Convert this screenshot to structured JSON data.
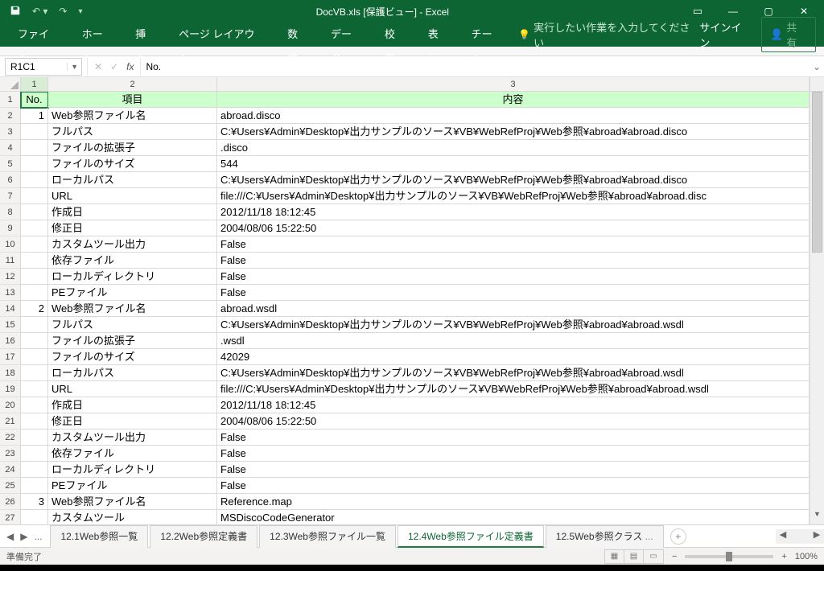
{
  "colors": {
    "brand": "#0e6534",
    "headerFill": "#ccffcc"
  },
  "titlebar": {
    "title": "DocVB.xls  [保護ビュー] - Excel",
    "icons": {
      "save": "save-icon",
      "undo": "undo-icon",
      "redo": "redo-icon",
      "customize": "chevron-down-icon"
    }
  },
  "windowControls": {
    "ribbonopts": "▭",
    "minimize": "—",
    "maximize": "▢",
    "close": "✕"
  },
  "ribbon": {
    "tabs": [
      "ファイル",
      "ホーム",
      "挿入",
      "ページ レイアウト",
      "数式",
      "データ",
      "校閲",
      "表示",
      "チーム"
    ],
    "tellme": "実行したい作業を入力してください",
    "signin": "サインイン",
    "share": "共有"
  },
  "formulaBar": {
    "nameBox": "R1C1",
    "fxValue": "No."
  },
  "columnHeaders": [
    "1",
    "2",
    "3"
  ],
  "headerRow": {
    "no": "No.",
    "item": "項目",
    "content": "内容"
  },
  "rows": [
    {
      "n": "1",
      "item": "Web参照ファイル名",
      "content": "abroad.disco"
    },
    {
      "n": "",
      "item": "フルパス",
      "content": "C:¥Users¥Admin¥Desktop¥出力サンプルのソース¥VB¥WebRefProj¥Web参照¥abroad¥abroad.disco"
    },
    {
      "n": "",
      "item": "ファイルの拡張子",
      "content": ".disco"
    },
    {
      "n": "",
      "item": "ファイルのサイズ",
      "content": "544"
    },
    {
      "n": "",
      "item": "ローカルパス",
      "content": "C:¥Users¥Admin¥Desktop¥出力サンプルのソース¥VB¥WebRefProj¥Web参照¥abroad¥abroad.disco"
    },
    {
      "n": "",
      "item": "URL",
      "content": "file:///C:¥Users¥Admin¥Desktop¥出力サンプルのソース¥VB¥WebRefProj¥Web参照¥abroad¥abroad.disc"
    },
    {
      "n": "",
      "item": "作成日",
      "content": "2012/11/18 18:12:45"
    },
    {
      "n": "",
      "item": "修正日",
      "content": "2004/08/06 15:22:50"
    },
    {
      "n": "",
      "item": "カスタムツール出力",
      "content": "False"
    },
    {
      "n": "",
      "item": "依存ファイル",
      "content": "False"
    },
    {
      "n": "",
      "item": "ローカルディレクトリ",
      "content": "False"
    },
    {
      "n": "",
      "item": "PEファイル",
      "content": "False"
    },
    {
      "n": "2",
      "item": "Web参照ファイル名",
      "content": "abroad.wsdl"
    },
    {
      "n": "",
      "item": "フルパス",
      "content": "C:¥Users¥Admin¥Desktop¥出力サンプルのソース¥VB¥WebRefProj¥Web参照¥abroad¥abroad.wsdl"
    },
    {
      "n": "",
      "item": "ファイルの拡張子",
      "content": ".wsdl"
    },
    {
      "n": "",
      "item": "ファイルのサイズ",
      "content": "42029"
    },
    {
      "n": "",
      "item": "ローカルパス",
      "content": "C:¥Users¥Admin¥Desktop¥出力サンプルのソース¥VB¥WebRefProj¥Web参照¥abroad¥abroad.wsdl"
    },
    {
      "n": "",
      "item": "URL",
      "content": "file:///C:¥Users¥Admin¥Desktop¥出力サンプルのソース¥VB¥WebRefProj¥Web参照¥abroad¥abroad.wsdl"
    },
    {
      "n": "",
      "item": "作成日",
      "content": "2012/11/18 18:12:45"
    },
    {
      "n": "",
      "item": "修正日",
      "content": "2004/08/06 15:22:50"
    },
    {
      "n": "",
      "item": "カスタムツール出力",
      "content": "False"
    },
    {
      "n": "",
      "item": "依存ファイル",
      "content": "False"
    },
    {
      "n": "",
      "item": "ローカルディレクトリ",
      "content": "False"
    },
    {
      "n": "",
      "item": "PEファイル",
      "content": "False"
    },
    {
      "n": "3",
      "item": "Web参照ファイル名",
      "content": "Reference.map"
    },
    {
      "n": "",
      "item": "カスタムツール",
      "content": "MSDiscoCodeGenerator"
    }
  ],
  "rowNumbers": [
    "1",
    "2",
    "3",
    "4",
    "5",
    "6",
    "7",
    "8",
    "9",
    "10",
    "11",
    "12",
    "13",
    "14",
    "15",
    "16",
    "17",
    "18",
    "19",
    "20",
    "21",
    "22",
    "23",
    "24",
    "25",
    "26",
    "27"
  ],
  "sheetTabs": {
    "hidden": "...",
    "tabs": [
      {
        "label": "12.1Web参照一覧",
        "active": false
      },
      {
        "label": "12.2Web参照定義書",
        "active": false
      },
      {
        "label": "12.3Web参照ファイル一覧",
        "active": false
      },
      {
        "label": "12.4Web参照ファイル定義書",
        "active": true
      },
      {
        "label": "12.5Web参照クラス",
        "active": false,
        "more": true
      }
    ]
  },
  "statusbar": {
    "ready": "準備完了",
    "zoom": "100%"
  }
}
